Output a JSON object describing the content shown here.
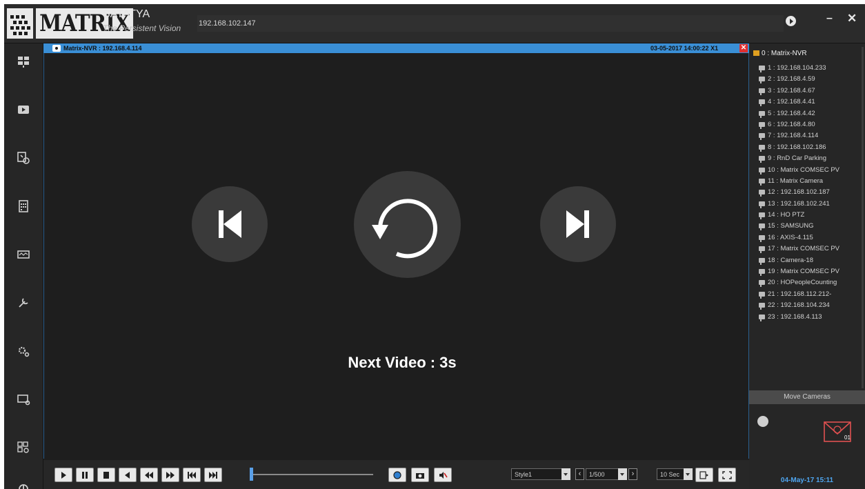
{
  "header": {
    "logo_text": "MATRIX",
    "brand": "SATATYA",
    "tagline": "The Persistent Vision",
    "server_ip": "192.168.102.147"
  },
  "left_nav": {
    "icons": [
      "live-view-icon",
      "playback-icon",
      "event-search-icon",
      "calendar-icon",
      "monitor-icon",
      "tools-icon",
      "settings-icon",
      "device-icon",
      "layout-icon",
      "power-icon"
    ]
  },
  "video": {
    "title": "Matrix-NVR : 192.168.4.114",
    "timestamp": "03-05-2017 14:00:22 X1",
    "next_video": "Next Video : 3s"
  },
  "controls": {
    "style_value": "Style1",
    "speed_value": "1/500",
    "interval_value": "10 Sec"
  },
  "tree": {
    "root": "0 : Matrix-NVR",
    "items": [
      "1 : 192.168.104.233",
      "2 : 192.168.4.59",
      "3 : 192.168.4.67",
      "4 : 192.168.4.41",
      "5 : 192.168.4.42",
      "6 : 192.168.4.80",
      "7 : 192.168.4.114",
      "8 : 192.168.102.186",
      "9 : RnD Car Parking",
      "10 : Matrix COMSEC PV",
      "11 : Matrix Camera",
      "12 : 192.168.102.187",
      "13 : 192.168.102.241",
      "14 : HO PTZ",
      "15 : SAMSUNG",
      "16 : AXIS-4.115",
      "17 : Matrix COMSEC PV",
      "18 : Camera-18",
      "19 : Matrix COMSEC PV",
      "20 : HOPeopleCounting",
      "21 : 192.168.112.212-",
      "22 : 192.168.104.234",
      "23 : 192.168.4.113"
    ],
    "move_cameras_label": "Move Cameras"
  },
  "notifications": {
    "mail_count": "01"
  },
  "status": {
    "clock": "04-May-17 15:11"
  }
}
